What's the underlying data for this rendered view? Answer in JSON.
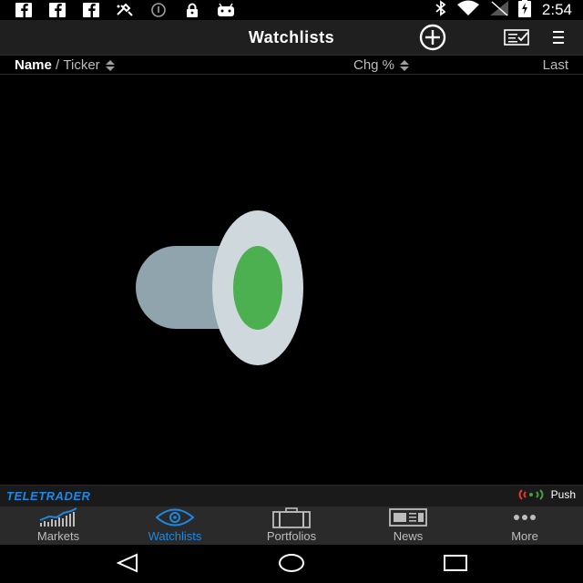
{
  "status_bar": {
    "time": "2:54",
    "left_icons": [
      "facebook-icon",
      "facebook-icon",
      "facebook-icon",
      "satellite-icon",
      "info-icon",
      "lock-icon",
      "android-icon"
    ],
    "right_icons": [
      "bluetooth-icon",
      "wifi-icon",
      "signal-icon",
      "battery-charging-icon"
    ]
  },
  "app_bar": {
    "title": "Watchlists",
    "actions": [
      "add-circle-icon",
      "edit-list-icon",
      "menu-icon"
    ]
  },
  "columns": {
    "name": "Name",
    "separator": "/",
    "ticker": "Ticker",
    "chg": "Chg %",
    "last": "Last"
  },
  "empty_state": {
    "illustration": "hat-icon",
    "colors": {
      "body": "#90A4AE",
      "brim": "#CFD8DC",
      "accent": "#4CAF50"
    }
  },
  "brand": {
    "logo": "TELETRADER",
    "push_label": "Push"
  },
  "tabs": [
    {
      "label": "Markets",
      "icon": "chart-icon",
      "active": false
    },
    {
      "label": "Watchlists",
      "icon": "eye-icon",
      "active": true
    },
    {
      "label": "Portfolios",
      "icon": "briefcase-icon",
      "active": false
    },
    {
      "label": "News",
      "icon": "newspaper-icon",
      "active": false
    },
    {
      "label": "More",
      "icon": "more-dots-icon",
      "active": false
    }
  ],
  "nav_bar": [
    "back-icon",
    "home-icon",
    "recents-icon"
  ],
  "accent_color": "#1E88E5"
}
